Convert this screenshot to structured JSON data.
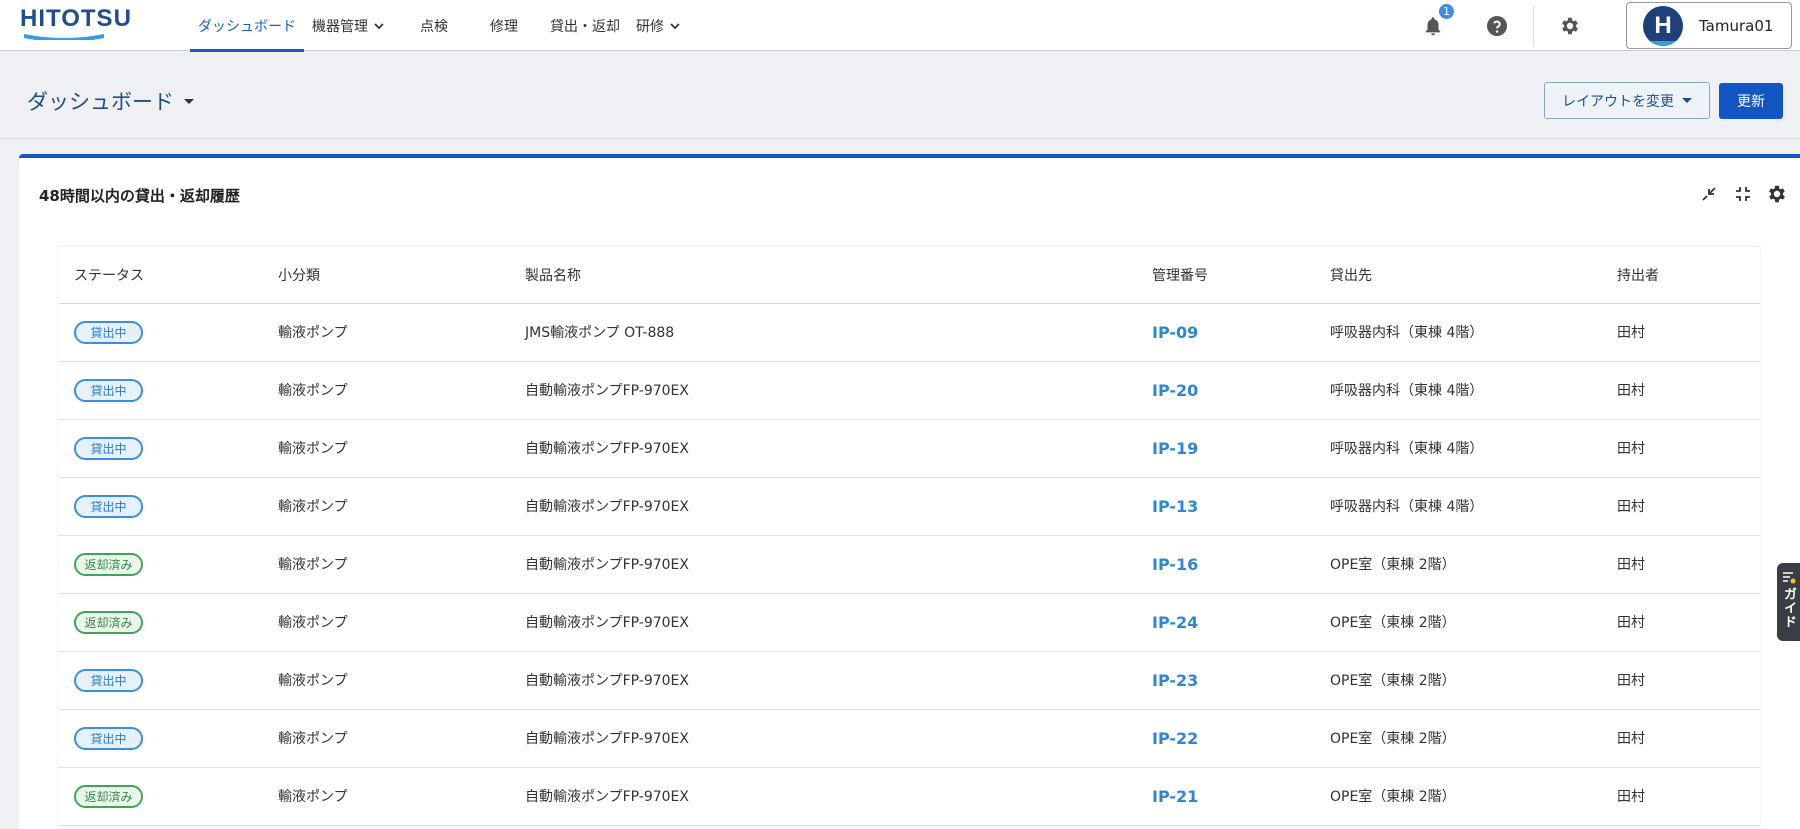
{
  "app": {
    "logo_text": "HITOTSU"
  },
  "nav": {
    "items": [
      {
        "label": "ダッシュボード",
        "active": true,
        "has_dropdown": false
      },
      {
        "label": "機器管理",
        "active": false,
        "has_dropdown": true
      },
      {
        "label": "点検",
        "active": false,
        "has_dropdown": false
      },
      {
        "label": "修理",
        "active": false,
        "has_dropdown": false
      },
      {
        "label": "貸出・返却",
        "active": false,
        "has_dropdown": false
      },
      {
        "label": "研修",
        "active": false,
        "has_dropdown": true
      }
    ]
  },
  "header_tools": {
    "notifications_count": "1",
    "icons": [
      "bell-icon",
      "help-icon",
      "gear-icon"
    ]
  },
  "user": {
    "avatar_letter": "H",
    "name": "Tamura01"
  },
  "page": {
    "title": "ダッシュボード",
    "layout_button": "レイアウトを変更",
    "refresh_button": "更新"
  },
  "widget": {
    "title": "48時間以内の貸出・返却履歴",
    "tools": [
      "minimize-icon",
      "collapse-icon",
      "widget-settings-icon"
    ],
    "columns": [
      "ステータス",
      "小分類",
      "製品名称",
      "管理番号",
      "貸出先",
      "持出者"
    ],
    "rows": [
      {
        "status": "貸出中",
        "status_type": "lend",
        "category": "輸液ポンプ",
        "product": "JMS輸液ポンプ OT-888",
        "mgmt_no": "IP-09",
        "destination": "呼吸器内科（東棟 4階）",
        "person": "田村"
      },
      {
        "status": "貸出中",
        "status_type": "lend",
        "category": "輸液ポンプ",
        "product": "自動輸液ポンプFP-970EX",
        "mgmt_no": "IP-20",
        "destination": "呼吸器内科（東棟 4階）",
        "person": "田村"
      },
      {
        "status": "貸出中",
        "status_type": "lend",
        "category": "輸液ポンプ",
        "product": "自動輸液ポンプFP-970EX",
        "mgmt_no": "IP-19",
        "destination": "呼吸器内科（東棟 4階）",
        "person": "田村"
      },
      {
        "status": "貸出中",
        "status_type": "lend",
        "category": "輸液ポンプ",
        "product": "自動輸液ポンプFP-970EX",
        "mgmt_no": "IP-13",
        "destination": "呼吸器内科（東棟 4階）",
        "person": "田村"
      },
      {
        "status": "返却済み",
        "status_type": "returned",
        "category": "輸液ポンプ",
        "product": "自動輸液ポンプFP-970EX",
        "mgmt_no": "IP-16",
        "destination": "OPE室（東棟 2階）",
        "person": "田村"
      },
      {
        "status": "返却済み",
        "status_type": "returned",
        "category": "輸液ポンプ",
        "product": "自動輸液ポンプFP-970EX",
        "mgmt_no": "IP-24",
        "destination": "OPE室（東棟 2階）",
        "person": "田村"
      },
      {
        "status": "貸出中",
        "status_type": "lend",
        "category": "輸液ポンプ",
        "product": "自動輸液ポンプFP-970EX",
        "mgmt_no": "IP-23",
        "destination": "OPE室（東棟 2階）",
        "person": "田村"
      },
      {
        "status": "貸出中",
        "status_type": "lend",
        "category": "輸液ポンプ",
        "product": "自動輸液ポンプFP-970EX",
        "mgmt_no": "IP-22",
        "destination": "OPE室（東棟 2階）",
        "person": "田村"
      },
      {
        "status": "返却済み",
        "status_type": "returned",
        "category": "輸液ポンプ",
        "product": "自動輸液ポンプFP-970EX",
        "mgmt_no": "IP-21",
        "destination": "OPE室（東棟 2階）",
        "person": "田村"
      }
    ]
  },
  "guide": {
    "label": "ガイド"
  },
  "colors": {
    "brand_primary": "#1256c4",
    "lend_status": "#3a8fe0",
    "returned_status": "#43a357",
    "link_blue": "#2f86d8"
  }
}
